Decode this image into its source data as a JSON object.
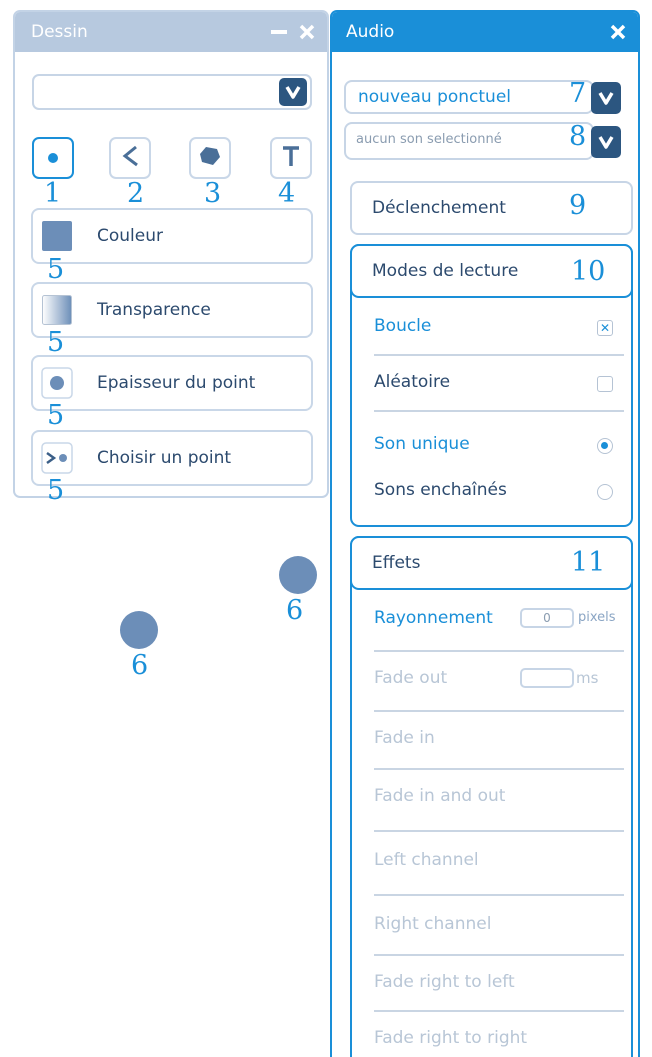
{
  "dessin": {
    "title": "Dessin",
    "minimize_icon": "minus-icon",
    "close_icon": "close-icon",
    "dropdown_value": "",
    "tools": [
      {
        "name": "point",
        "icon": "point-icon"
      },
      {
        "name": "line",
        "icon": "polyline-icon"
      },
      {
        "name": "shape",
        "icon": "polygon-icon"
      },
      {
        "name": "text",
        "icon": "text-T-icon"
      }
    ],
    "options": [
      {
        "label": "Couleur",
        "icon": "color-swatch-icon"
      },
      {
        "label": "Transparence",
        "icon": "gradient-swatch-icon"
      },
      {
        "label": "Epaisseur du point",
        "icon": "point-size-icon"
      },
      {
        "label": "Choisir un point",
        "icon": "choose-point-icon"
      }
    ]
  },
  "audio": {
    "title": "Audio",
    "close_icon": "close-icon",
    "mode_select": "nouveau ponctuel",
    "sound_select": "aucun son selectionné",
    "declenchement": "Déclenchement",
    "lecture": {
      "title": "Modes de lecture",
      "boucle": "Boucle",
      "boucle_checked": true,
      "aleatoire": "Aléatoire",
      "aleatoire_checked": false,
      "son_unique": "Son unique",
      "sons_enchaines": "Sons enchaînés",
      "selected_mode": "Son unique"
    },
    "effets": {
      "title": "Effets",
      "rayonnement": "Rayonnement",
      "rayonnement_value": "0",
      "rayonnement_unit": "pixels",
      "fade_out": "Fade out",
      "fade_out_value": "",
      "fade_out_unit": "ms",
      "items": [
        "Fade in",
        "Fade in and out",
        "Left channel",
        "Right channel",
        "Fade right to left",
        "Fade right to right"
      ]
    }
  },
  "annotations": {
    "n1": "1",
    "n2": "2",
    "n3": "3",
    "n4": "4",
    "n5": "5",
    "n6": "6",
    "n7": "7",
    "n8": "8",
    "n9": "9",
    "n10": "10",
    "n11": "11"
  },
  "colors": {
    "accent": "#1a8fd8",
    "dark_button": "#2c5680",
    "inactive_titlebar": "#b7c9df",
    "point_fill": "#6c8eb8"
  }
}
